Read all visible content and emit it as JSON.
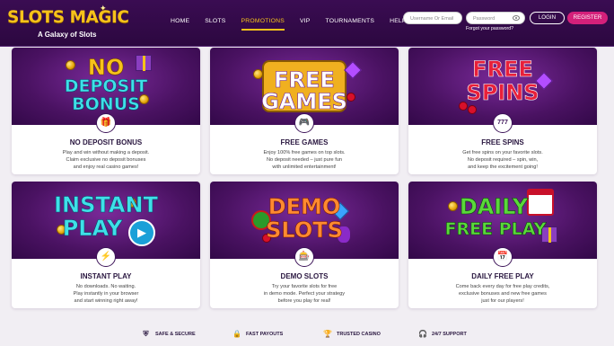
{
  "header": {
    "logo": "SLOTS MAGIC",
    "tagline": "A Galaxy of Slots",
    "nav": [
      "HOME",
      "SLOTS",
      "PROMOTIONS",
      "VIP",
      "TOURNAMENTS",
      "HELP"
    ],
    "active_nav": "PROMOTIONS",
    "username_placeholder": "Username Or Email",
    "password_placeholder": "Password",
    "forgot_password": "Forgot your password?",
    "login_label": "LOGIN",
    "register_label": "REGISTER"
  },
  "cards": [
    {
      "banner": [
        "NO",
        "DEPOSIT",
        "BONUS"
      ],
      "icon": "gift-icon",
      "title": "NO DEPOSIT BONUS",
      "desc": "Play and win without making a deposit.\nClaim exclusive no deposit bonuses\nand enjoy real casino games!"
    },
    {
      "banner": [
        "FREE",
        "GAMES"
      ],
      "icon": "gamepad-icon",
      "title": "FREE GAMES",
      "desc": "Enjoy 100% free games on top slots.\nNo deposit needed – just pure fun\nwith unlimited entertainment!"
    },
    {
      "banner": [
        "FREE",
        "SPINS"
      ],
      "icon": "777-icon",
      "icon_text": "777",
      "title": "FREE SPINS",
      "desc": "Get free spins on your favorite slots.\nNo deposit required – spin, win,\nand keep the excitement going!"
    },
    {
      "banner": [
        "INSTANT",
        "PLAY"
      ],
      "icon": "lightning-icon",
      "title": "INSTANT PLAY",
      "desc": "No downloads. No waiting.\nPlay instantly in your browser\nand start winning right away!"
    },
    {
      "banner": [
        "DEMO",
        "SLOTS"
      ],
      "icon": "slot-machine-icon",
      "title": "DEMO SLOTS",
      "desc": "Try your favorite slots for free\nin demo mode. Perfect your strategy\nbefore you play for real!"
    },
    {
      "banner": [
        "DAILY",
        "FREE PLAY"
      ],
      "icon": "calendar-icon",
      "title": "DAILY FREE PLAY",
      "desc": "Come back every day for free play credits,\nexclusive bonuses and new free games\njust for our players!"
    }
  ],
  "features": [
    {
      "icon": "shield-icon",
      "label": "SAFE & SECURE"
    },
    {
      "icon": "lock-icon",
      "label": "FAST PAYOUTS"
    },
    {
      "icon": "trophy-icon",
      "label": "TRUSTED CASINO"
    },
    {
      "icon": "headset-icon",
      "label": "24/7 SUPPORT"
    }
  ],
  "colors": {
    "header_bg": "#3a0c52",
    "accent_gold": "#f6c21a",
    "register_pink": "#d4207a",
    "card_banner": "#4a1262"
  }
}
